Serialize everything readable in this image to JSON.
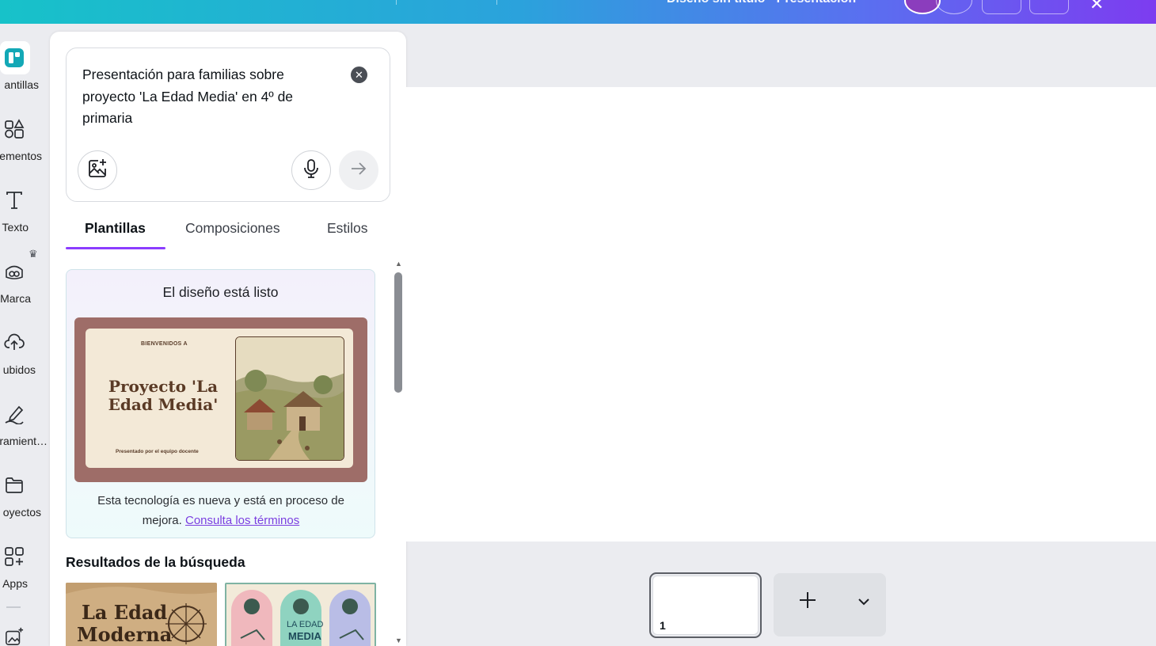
{
  "topbar": {
    "doc_title": "Diseño sin título · Presentación"
  },
  "rail": {
    "items": [
      {
        "label": "antillas",
        "icon": "templates-icon"
      },
      {
        "label": "ementos",
        "icon": "elements-icon"
      },
      {
        "label": "Texto",
        "icon": "text-icon"
      },
      {
        "label": "Marca",
        "icon": "brand-icon"
      },
      {
        "label": "ubidos",
        "icon": "upload-cloud-icon"
      },
      {
        "label": "ramient…",
        "icon": "draw-tools-icon"
      },
      {
        "label": "oyectos",
        "icon": "folder-icon"
      },
      {
        "label": "Apps",
        "icon": "apps-icon"
      }
    ]
  },
  "prompt": {
    "text": "Presentación para familias sobre proyecto 'La Edad Media' en 4º de primaria"
  },
  "tabs": [
    {
      "label": "Plantillas",
      "active": true
    },
    {
      "label": "Composiciones",
      "active": false
    },
    {
      "label": "Estilos",
      "active": false
    }
  ],
  "ready_card": {
    "title": "El diseño está listo",
    "slide_welcome": "BIENVENIDOS A",
    "slide_title": "Proyecto 'La Edad Media'",
    "slide_subtitle": "Presentado por el equipo docente",
    "note": "Esta tecnología es nueva y está en proceso de mejora.",
    "terms_link": "Consulta los términos"
  },
  "results": {
    "title": "Resultados de la búsqueda",
    "items": [
      {
        "text_line1": "La Edad",
        "text_line2": "Moderna"
      },
      {
        "text_line1": "LA EDAD",
        "text_line2": "MEDIA"
      }
    ]
  },
  "pages": {
    "current_page": "1"
  },
  "colors": {
    "accent": "#8b3dff",
    "link": "#7b3ee0",
    "preview_frame": "#9e6d68"
  }
}
